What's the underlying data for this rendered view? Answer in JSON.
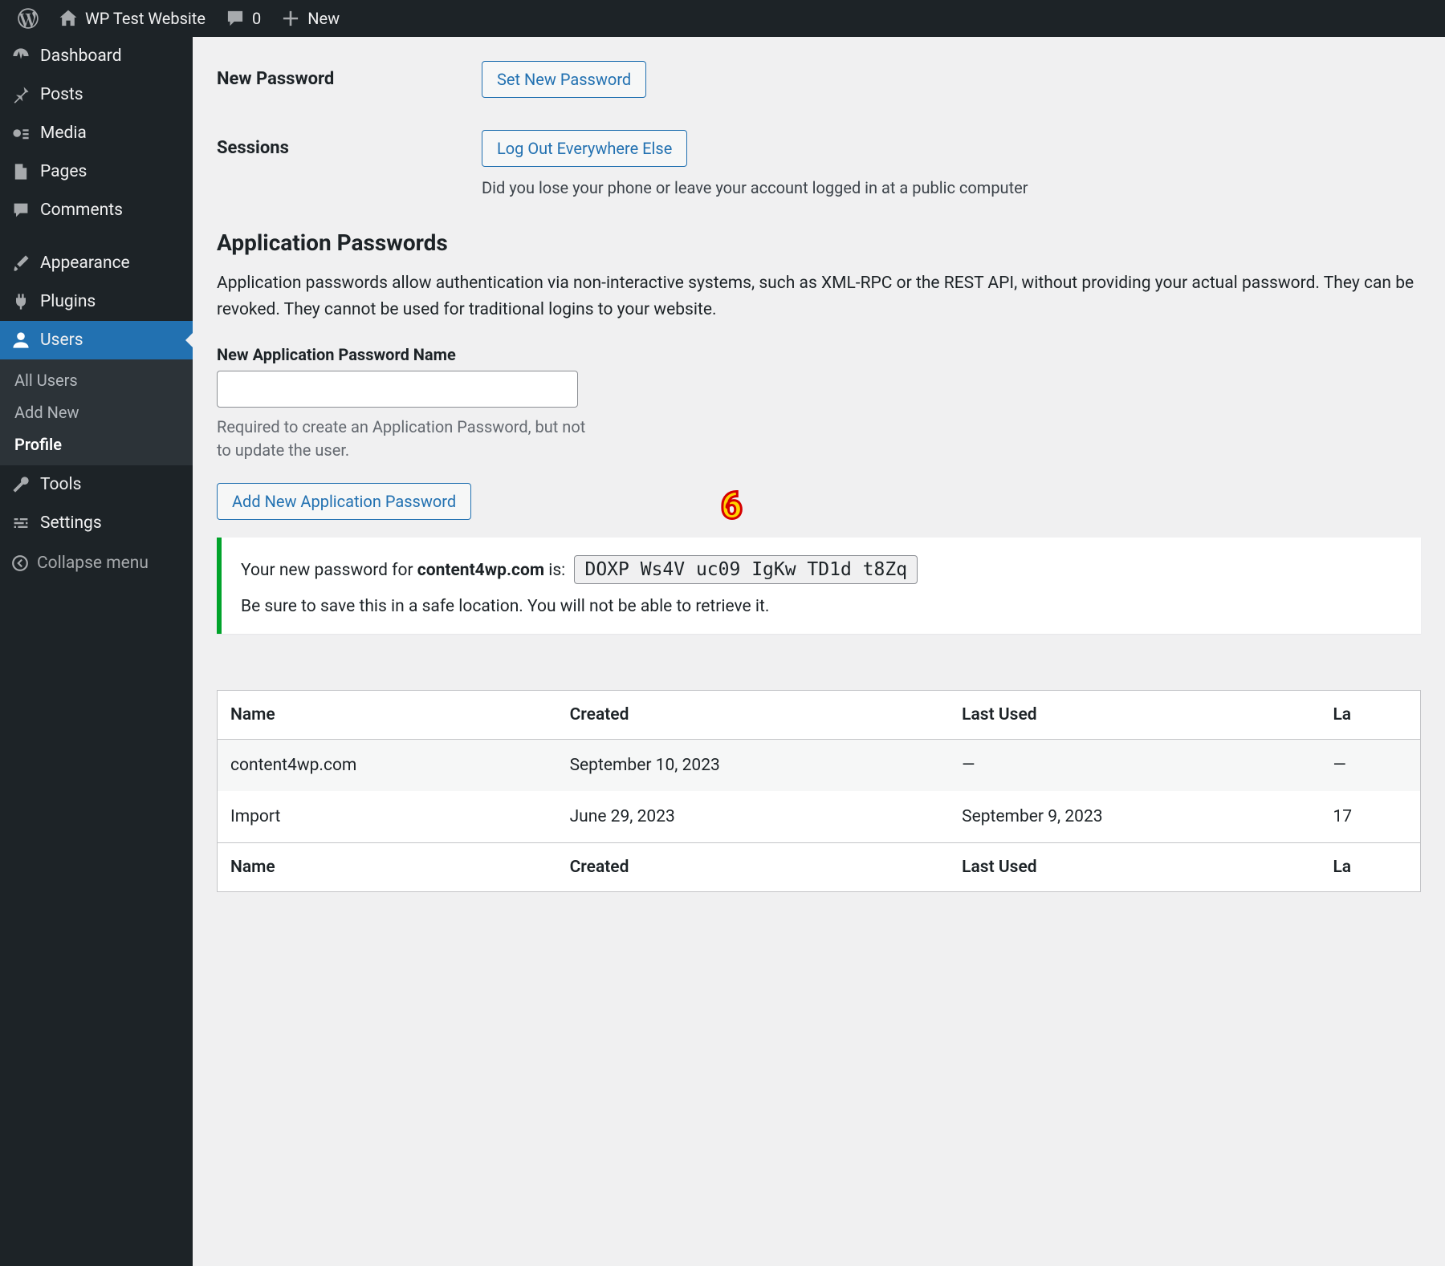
{
  "adminbar": {
    "site_name": "WP Test Website",
    "comments_count": "0",
    "new_label": "New"
  },
  "sidebar": {
    "items": [
      {
        "icon": "dashboard",
        "label": "Dashboard"
      },
      {
        "icon": "pin",
        "label": "Posts"
      },
      {
        "icon": "media",
        "label": "Media"
      },
      {
        "icon": "page",
        "label": "Pages"
      },
      {
        "icon": "comment",
        "label": "Comments"
      },
      {
        "icon": "brush",
        "label": "Appearance"
      },
      {
        "icon": "plug",
        "label": "Plugins"
      },
      {
        "icon": "user",
        "label": "Users"
      },
      {
        "icon": "wrench",
        "label": "Tools"
      },
      {
        "icon": "sliders",
        "label": "Settings"
      }
    ],
    "submenu": [
      "All Users",
      "Add New",
      "Profile"
    ],
    "collapse": "Collapse menu"
  },
  "sections": {
    "new_password": {
      "label": "New Password",
      "button": "Set New Password"
    },
    "sessions": {
      "label": "Sessions",
      "button": "Log Out Everywhere Else",
      "desc": "Did you lose your phone or leave your account logged in at a public computer"
    },
    "app_passwords": {
      "heading": "Application Passwords",
      "description": "Application passwords allow authentication via non-interactive systems, such as XML-RPC or the REST API, without providing your actual password. They can be revoked. They cannot be used for traditional logins to your website.",
      "input_label": "New Application Password Name",
      "input_value": "",
      "input_hint": "Required to create an Application Password, but not to update the user.",
      "add_button": "Add New Application Password"
    },
    "notice": {
      "prefix": "Your new password for ",
      "target": "content4wp.com",
      "suffix": " is: ",
      "password": "DOXP Ws4V uc09 IgKw TD1d t8Zq",
      "warning": "Be sure to save this in a safe location. You will not be able to retrieve it."
    },
    "table": {
      "columns": [
        "Name",
        "Created",
        "Last Used",
        "La"
      ],
      "rows": [
        {
          "name": "content4wp.com",
          "created": "September 10, 2023",
          "last_used": "—",
          "last": "—"
        },
        {
          "name": "Import",
          "created": "June 29, 2023",
          "last_used": "September 9, 2023",
          "last": "17"
        }
      ]
    }
  },
  "annotation": {
    "marker": "6"
  }
}
